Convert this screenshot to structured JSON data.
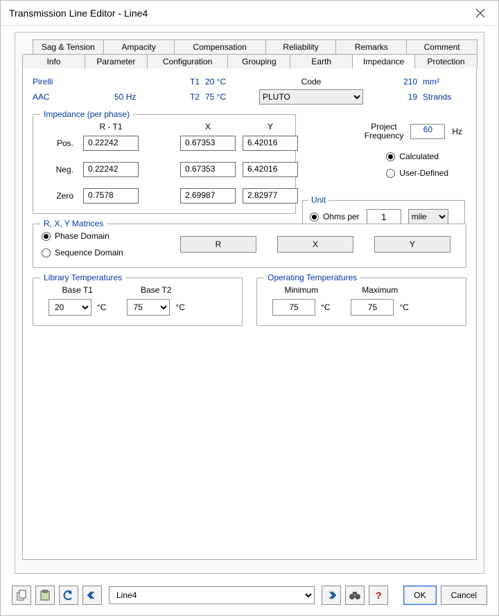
{
  "window": {
    "title": "Transmission Line Editor - Line4"
  },
  "tabs_row1": [
    "Sag & Tension",
    "Ampacity",
    "Compensation",
    "Reliability",
    "Remarks",
    "Comment"
  ],
  "tabs_row2": [
    "Info",
    "Parameter",
    "Configuration",
    "Grouping",
    "Earth",
    "Impedance",
    "Protection"
  ],
  "active_tab": "Impedance",
  "header": {
    "manufacturer": "Pirelli",
    "t1_label": "T1",
    "t1_val": "20 °C",
    "code_label": "Code",
    "size_val": "210",
    "size_unit": "mm²",
    "material": "AAC",
    "freq_val": "50",
    "freq_unit": "Hz",
    "t2_label": "T2",
    "t2_val": "75 °C",
    "code_select": "PLUTO",
    "strands_val": "19",
    "strands_unit": "Strands"
  },
  "impedance": {
    "legend": "Impedance (per phase)",
    "col_r": "R - T1",
    "col_x": "X",
    "col_y": "Y",
    "rows": {
      "pos": {
        "label": "Pos.",
        "r": "0.22242",
        "x": "0.67353",
        "y": "6.42016"
      },
      "neg": {
        "label": "Neg.",
        "r": "0.22242",
        "x": "0.67353",
        "y": "6.42016"
      },
      "zero": {
        "label": "Zero",
        "r": "0.7578",
        "x": "2.69987",
        "y": "2.82977"
      }
    }
  },
  "project_freq": {
    "label_l1": "Project",
    "label_l2": "Frequency",
    "value": "60",
    "unit": "Hz"
  },
  "calc": {
    "calculated": "Calculated",
    "user_defined": "User-Defined",
    "selected": "calculated"
  },
  "unit": {
    "legend": "Unit",
    "ohms_per": "Ohms per",
    "ohms": "Ohms",
    "per_value": "1",
    "per_unit": "mile",
    "selected": "ohms_per"
  },
  "matrices": {
    "legend": "R, X, Y Matrices",
    "phase": "Phase Domain",
    "sequence": "Sequence Domain",
    "selected": "phase",
    "btn_r": "R",
    "btn_x": "X",
    "btn_y": "Y"
  },
  "lib_temps": {
    "legend": "Library Temperatures",
    "base_t1": "Base T1",
    "base_t2": "Base T2",
    "t1_val": "20",
    "t2_val": "75",
    "unit": "°C"
  },
  "op_temps": {
    "legend": "Operating Temperatures",
    "min": "Minimum",
    "max": "Maximum",
    "min_val": "75",
    "max_val": "75",
    "unit": "°C"
  },
  "bottom": {
    "nav_value": "Line4",
    "ok": "OK",
    "cancel": "Cancel"
  }
}
